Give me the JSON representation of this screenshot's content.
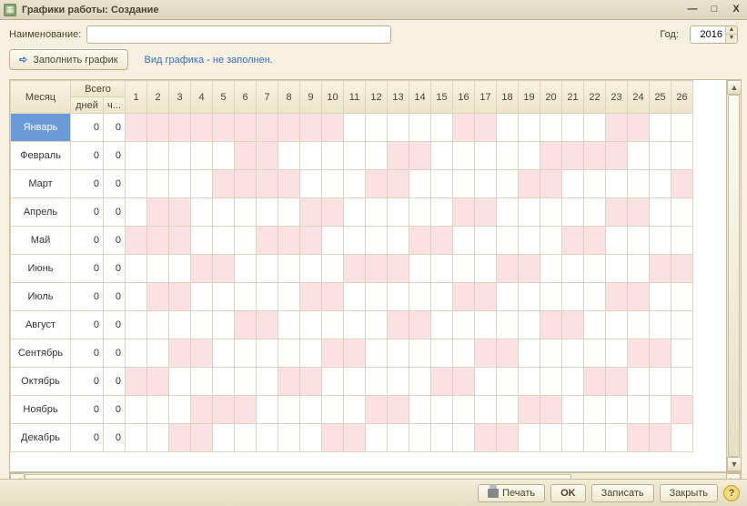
{
  "window": {
    "title": "Графики работы: Создание",
    "icons": {
      "minimize": "—",
      "maximize": "□",
      "close": "X"
    }
  },
  "toolbar": {
    "name_label": "Наименование:",
    "name_value": "",
    "year_label": "Год:",
    "year_value": "2016",
    "fill_button": "Заполнить график",
    "status_text": "Вид графика - не заполнен."
  },
  "grid": {
    "headers": {
      "month": "Месяц",
      "total": "Всего",
      "days": "дней",
      "hours": "ч..."
    },
    "day_columns": [
      "1",
      "2",
      "3",
      "4",
      "5",
      "6",
      "7",
      "8",
      "9",
      "10",
      "11",
      "12",
      "13",
      "14",
      "15",
      "16",
      "17",
      "18",
      "19",
      "20",
      "21",
      "22",
      "23",
      "24",
      "25",
      "26"
    ],
    "rows": [
      {
        "month": "Январь",
        "days": 0,
        "hours": 0,
        "pink": [
          1,
          2,
          3,
          4,
          5,
          6,
          7,
          8,
          9,
          10,
          16,
          17,
          23,
          24
        ]
      },
      {
        "month": "Февраль",
        "days": 0,
        "hours": 0,
        "pink": [
          6,
          7,
          13,
          14,
          20,
          21,
          22,
          23
        ]
      },
      {
        "month": "Март",
        "days": 0,
        "hours": 0,
        "pink": [
          5,
          6,
          7,
          8,
          12,
          13,
          19,
          20,
          26
        ]
      },
      {
        "month": "Апрель",
        "days": 0,
        "hours": 0,
        "pink": [
          2,
          3,
          9,
          10,
          16,
          17,
          23,
          24
        ]
      },
      {
        "month": "Май",
        "days": 0,
        "hours": 0,
        "pink": [
          1,
          2,
          3,
          7,
          8,
          9,
          14,
          15,
          21,
          22
        ]
      },
      {
        "month": "Июнь",
        "days": 0,
        "hours": 0,
        "pink": [
          4,
          5,
          11,
          12,
          13,
          18,
          19,
          25,
          26
        ]
      },
      {
        "month": "Июль",
        "days": 0,
        "hours": 0,
        "pink": [
          2,
          3,
          9,
          10,
          16,
          17,
          23,
          24
        ]
      },
      {
        "month": "Август",
        "days": 0,
        "hours": 0,
        "pink": [
          6,
          7,
          13,
          14,
          20,
          21
        ]
      },
      {
        "month": "Сентябрь",
        "days": 0,
        "hours": 0,
        "pink": [
          3,
          4,
          10,
          11,
          17,
          18,
          24,
          25
        ]
      },
      {
        "month": "Октябрь",
        "days": 0,
        "hours": 0,
        "pink": [
          1,
          2,
          8,
          9,
          15,
          16,
          22,
          23
        ]
      },
      {
        "month": "Ноябрь",
        "days": 0,
        "hours": 0,
        "pink": [
          4,
          5,
          6,
          12,
          13,
          19,
          20,
          26
        ]
      },
      {
        "month": "Декабрь",
        "days": 0,
        "hours": 0,
        "pink": [
          3,
          4,
          10,
          11,
          17,
          18,
          24,
          25
        ]
      }
    ],
    "selected_row": 0
  },
  "footer": {
    "print": "Печать",
    "ok": "OK",
    "save": "Записать",
    "close": "Закрыть",
    "help": "?"
  }
}
